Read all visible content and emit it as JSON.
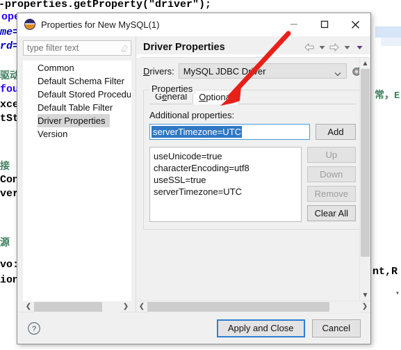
{
  "background_code": {
    "lines": [
      "-properties.getProperty(\"driver\");",
      "ope",
      "me=",
      "rd=",
      "驱动",
      "fou",
      "xce",
      "tSt",
      "接",
      "Con",
      "ver",
      "源",
      "vo:",
      "ion",
      "常，E",
      "nt,R"
    ]
  },
  "dialog": {
    "title": "Properties for New MySQL(1)",
    "app_icon": "eclipse-icon",
    "window_buttons": {
      "minimize": "minimize-icon",
      "maximize": "maximize-icon",
      "close": "close-icon"
    },
    "left_pane": {
      "filter_placeholder": "type filter text",
      "filter_value": "",
      "clear_icon": "eraser-icon",
      "tree_items": [
        {
          "label": "Common",
          "selected": false
        },
        {
          "label": "Default Schema Filter",
          "selected": false
        },
        {
          "label": "Default Stored Procedur",
          "selected": false
        },
        {
          "label": "Default Table Filter",
          "selected": false
        },
        {
          "label": "Driver Properties",
          "selected": true
        },
        {
          "label": "Version",
          "selected": false
        }
      ]
    },
    "right_pane": {
      "title": "Driver Properties",
      "toolbar": [
        {
          "name": "back-arrow-icon"
        },
        {
          "name": "back-dropdown-caret-icon"
        },
        {
          "name": "forward-arrow-icon"
        },
        {
          "name": "forward-dropdown-caret-icon"
        },
        {
          "name": "menu-caret-icon"
        }
      ],
      "drivers": {
        "label": "Drivers:",
        "label_mnemonic": "D",
        "label_rest": "rivers:",
        "selected": "MySQL JDBC Driver",
        "caret_icon": "chevron-down-icon",
        "new_driver_icon": "new-driver-icon"
      },
      "properties_group": {
        "legend": "Properties",
        "tabs": [
          {
            "label": "General",
            "mnemonic_index": 1,
            "active": false
          },
          {
            "label": "Optional",
            "mnemonic_index": 0,
            "active": true
          }
        ],
        "additional_properties_label": "Additional properties:",
        "input_value": "serverTimezone=UTC",
        "input_selected": true,
        "add_button": "Add",
        "list_items": [
          "useUnicode=true",
          "characterEncoding=utf8",
          "useSSL=true",
          "serverTimezone=UTC"
        ],
        "list_buttons": [
          {
            "label": "Up",
            "enabled": false
          },
          {
            "label": "Down",
            "enabled": false
          },
          {
            "label": "Remove",
            "enabled": false
          },
          {
            "label": "Clear All",
            "enabled": true
          }
        ]
      }
    },
    "footer": {
      "help_icon": "help-icon",
      "apply_button": "Apply and Close",
      "cancel_button": "Cancel"
    }
  },
  "annotation": {
    "arrow": "red-arrow-pointing-to-optional-tab",
    "color": "#e8201a"
  }
}
